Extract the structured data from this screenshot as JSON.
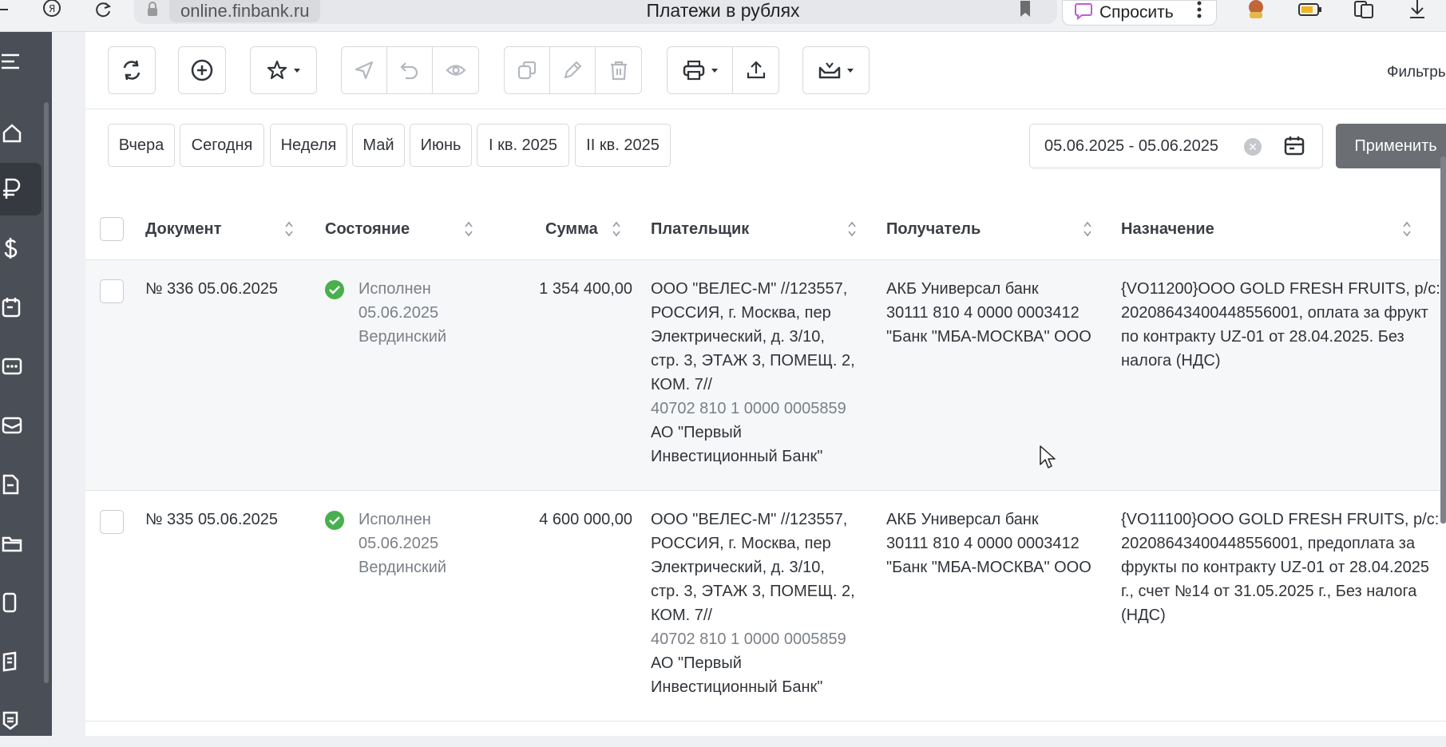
{
  "browser": {
    "domain": "online.finbank.ru",
    "title": "Платежи в рублях",
    "ask_label": "Спросить"
  },
  "toolbar": {
    "filters_label": "Фильтры"
  },
  "periods": [
    "Вчера",
    "Сегодня",
    "Неделя",
    "Май",
    "Июнь",
    "I кв. 2025",
    "II кв. 2025"
  ],
  "date_range": "05.06.2025 - 05.06.2025",
  "apply_label": "Применить",
  "table": {
    "headers": {
      "document": "Документ",
      "status": "Состояние",
      "amount": "Сумма",
      "payer": "Плательщик",
      "recipient": "Получатель",
      "purpose": "Назначение"
    },
    "rows": [
      {
        "document": "№ 336 05.06.2025",
        "status_name": "Исполнен",
        "status_date": "05.06.2025",
        "status_user": "Вердинский",
        "amount": "1 354 400,00",
        "payer_lines": [
          "ООО \"ВЕЛЕС-М\" //123557,",
          "РОССИЯ, г. Москва, пер",
          "Электрический, д. 3/10,",
          "стр. 3, ЭТАЖ 3, ПОМЕЩ. 2,",
          "КОМ. 7//"
        ],
        "payer_account": "40702 810 1 0000 0005859",
        "payer_bank_lines": [
          "АО \"Первый",
          "Инвестиционный Банк\""
        ],
        "recipient_lines": [
          "АКБ Универсал банк",
          "30111 810 4 0000 0003412",
          "\"Банк \"МБА-МОСКВА\" ООО"
        ],
        "purpose_lines": [
          "{VO11200}ООО GOLD FRESH FRUITS, р/с:",
          "20208643400448556001, оплата за фрукт",
          "по контракту UZ-01 от 28.04.2025. Без",
          "налога (НДС)"
        ]
      },
      {
        "document": "№ 335 05.06.2025",
        "status_name": "Исполнен",
        "status_date": "05.06.2025",
        "status_user": "Вердинский",
        "amount": "4 600 000,00",
        "payer_lines": [
          "ООО \"ВЕЛЕС-М\" //123557,",
          "РОССИЯ, г. Москва, пер",
          "Электрический, д. 3/10,",
          "стр. 3, ЭТАЖ 3, ПОМЕЩ. 2,",
          "КОМ. 7//"
        ],
        "payer_account": "40702 810 1 0000 0005859",
        "payer_bank_lines": [
          "АО \"Первый",
          "Инвестиционный Банк\""
        ],
        "recipient_lines": [
          "АКБ Универсал банк",
          "30111 810 4 0000 0003412",
          "\"Банк \"МБА-МОСКВА\" ООО"
        ],
        "purpose_lines": [
          "{VO11100}ООО GOLD FRESH FRUITS, р/с:",
          "20208643400448556001, предоплата за",
          "фрукты по контракту UZ-01 от 28.04.2025",
          "г., счет №14 от 31.05.2025 г., Без налога",
          "(НДС)"
        ]
      }
    ]
  }
}
